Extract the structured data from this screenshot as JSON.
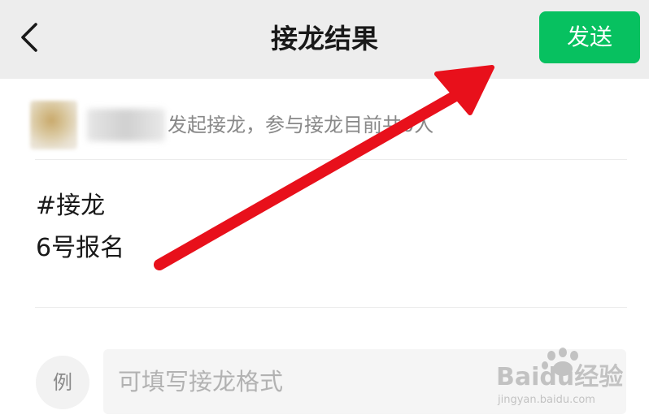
{
  "header": {
    "title": "接龙结果",
    "send_label": "发送",
    "back_icon": "chevron-left-icon",
    "accent_color": "#07c160"
  },
  "initiator": {
    "text": "发起接龙，参与接龙目前共0人"
  },
  "content": {
    "lines": [
      "#接龙",
      "6号报名"
    ]
  },
  "example": {
    "badge_label": "例",
    "placeholder": "可填写接龙格式"
  },
  "annotation": {
    "arrow_color": "#e8101b"
  },
  "watermark": {
    "brand_text": "Baidu经验",
    "url_text": "jingyan.baidu.com"
  }
}
